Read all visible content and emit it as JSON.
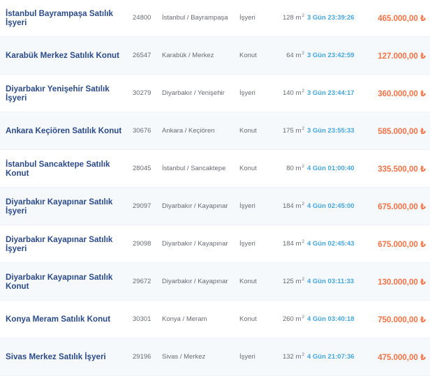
{
  "listings": [
    {
      "title": "İstanbul Bayrampaşa Satılık İşyeri",
      "id": "24800",
      "location": "İstanbul / Bayrampaşa",
      "type": "İşyeri",
      "area": "128 m",
      "area_sup": "2",
      "remaining": "3 Gün 23:39:26",
      "price": "465.000,00 ₺"
    },
    {
      "title": "Karabük Merkez Satılık Konut",
      "id": "26547",
      "location": "Karabük / Merkez",
      "type": "Konut",
      "area": "64 m",
      "area_sup": "2",
      "remaining": "3 Gün 23:42:59",
      "price": "127.000,00 ₺"
    },
    {
      "title": "Diyarbakır Yenişehir Satılık İşyeri",
      "id": "30279",
      "location": "Diyarbakır / Yenişehir",
      "type": "İşyeri",
      "area": "140 m",
      "area_sup": "2",
      "remaining": "3 Gün 23:44:17",
      "price": "360.000,00 ₺"
    },
    {
      "title": "Ankara Keçiören Satılık Konut",
      "id": "30676",
      "location": "Ankara / Keçiören",
      "type": "Konut",
      "area": "175 m",
      "area_sup": "2",
      "remaining": "3 Gün 23:55:33",
      "price": "585.000,00 ₺"
    },
    {
      "title": "İstanbul Sancaktepe Satılık Konut",
      "id": "28045",
      "location": "İstanbul / Sancaktepe",
      "type": "Konut",
      "area": "80 m",
      "area_sup": "2",
      "remaining": "4 Gün 01:00:40",
      "price": "335.500,00 ₺"
    },
    {
      "title": "Diyarbakır Kayapınar Satılık İşyeri",
      "id": "29097",
      "location": "Diyarbakır / Kayapınar",
      "type": "İşyeri",
      "area": "184 m",
      "area_sup": "2",
      "remaining": "4 Gün 02:45:00",
      "price": "675.000,00 ₺"
    },
    {
      "title": "Diyarbakır Kayapınar Satılık İşyeri",
      "id": "29098",
      "location": "Diyarbakır / Kayapınar",
      "type": "İşyeri",
      "area": "184 m",
      "area_sup": "2",
      "remaining": "4 Gün 02:45:43",
      "price": "675.000,00 ₺"
    },
    {
      "title": "Diyarbakır Kayapınar Satılık Konut",
      "id": "29672",
      "location": "Diyarbakır / Kayapınar",
      "type": "Konut",
      "area": "125 m",
      "area_sup": "2",
      "remaining": "4 Gün 03:11:33",
      "price": "130.000,00 ₺"
    },
    {
      "title": "Konya Meram Satılık Konut",
      "id": "30301",
      "location": "Konya / Meram",
      "type": "Konut",
      "area": "260 m",
      "area_sup": "2",
      "remaining": "4 Gün 03:40:18",
      "price": "750.000,00 ₺"
    },
    {
      "title": "Sivas Merkez Satılık İşyeri",
      "id": "29196",
      "location": "Sivas / Merkez",
      "type": "İşyeri",
      "area": "132 m",
      "area_sup": "2",
      "remaining": "4 Gün 21:07:36",
      "price": "475.000,00 ₺"
    }
  ]
}
